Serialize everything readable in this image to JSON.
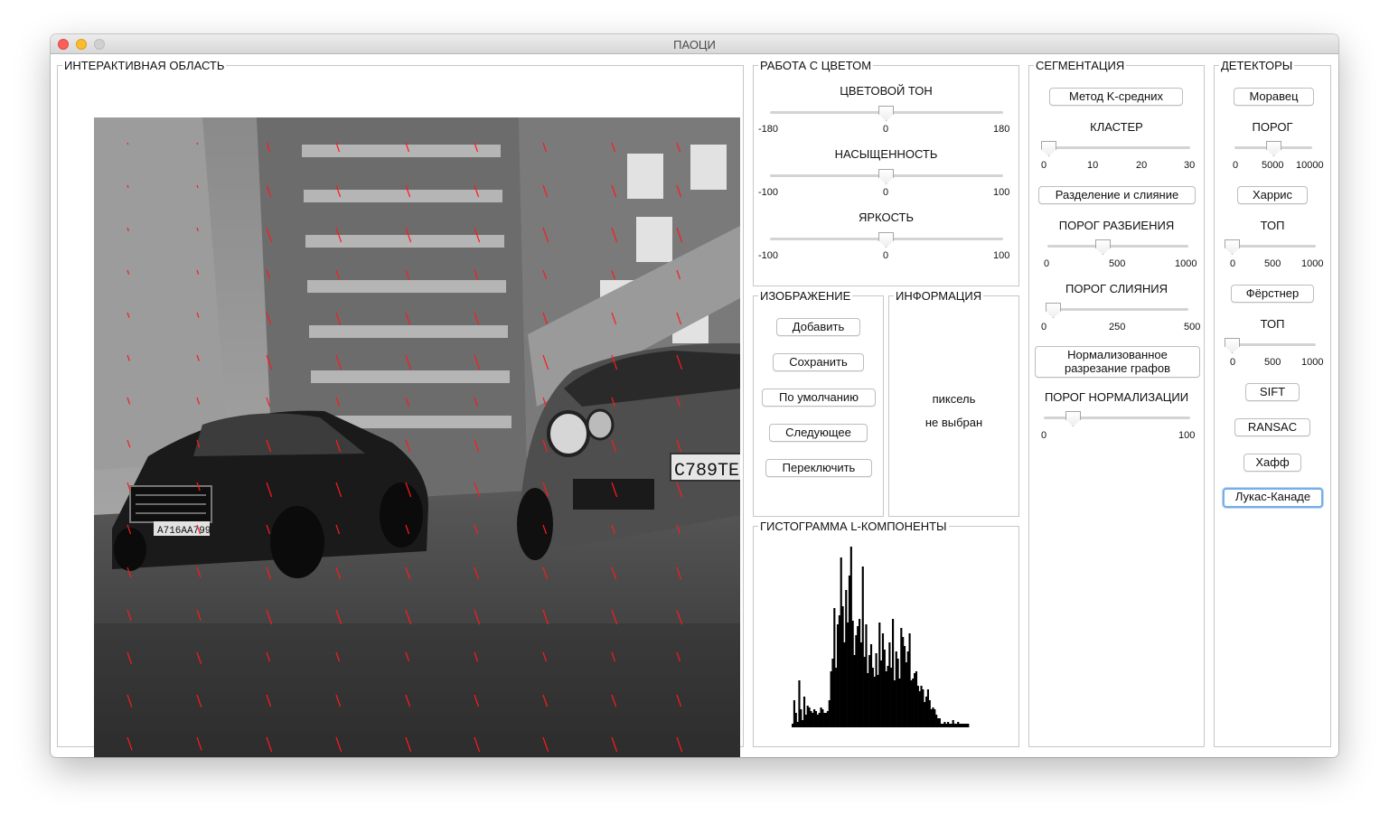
{
  "window": {
    "title": "ПАОЦИ"
  },
  "interactive": {
    "legend": "ИНТЕРАКТИВНАЯ ОБЛАСТЬ",
    "plates": [
      "А716АА799",
      "С789ТЕ"
    ]
  },
  "color": {
    "legend": "РАБОТА С ЦВЕТОМ",
    "hue": {
      "label": "ЦВЕТОВОЙ ТОН",
      "min": "-180",
      "mid": "0",
      "max": "180",
      "value": 0
    },
    "saturation": {
      "label": "НАСЫЩЕННОСТЬ",
      "min": "-100",
      "mid": "0",
      "max": "100",
      "value": 0
    },
    "brightness": {
      "label": "ЯРКОСТЬ",
      "min": "-100",
      "mid": "0",
      "max": "100",
      "value": 0
    }
  },
  "image": {
    "legend": "ИЗОБРАЖЕНИЕ",
    "add": "Добавить",
    "save": "Сохранить",
    "default": "По умолчанию",
    "next": "Следующее",
    "switch": "Переключить"
  },
  "info": {
    "legend": "ИНФОРМАЦИЯ",
    "line1": "пиксель",
    "line2": "не выбран"
  },
  "histogram": {
    "legend": "ГИСТОГРАММА L-КОМПОНЕНТЫ",
    "bars": [
      2,
      15,
      8,
      3,
      26,
      10,
      4,
      17,
      7,
      12,
      11,
      9,
      8,
      10,
      9,
      7,
      8,
      11,
      10,
      8,
      8,
      9,
      15,
      31,
      38,
      66,
      33,
      57,
      62,
      94,
      67,
      47,
      76,
      58,
      84,
      100,
      59,
      40,
      51,
      56,
      60,
      47,
      89,
      39,
      57,
      30,
      40,
      46,
      33,
      28,
      41,
      29,
      58,
      37,
      52,
      43,
      31,
      34,
      47,
      33,
      60,
      26,
      42,
      38,
      27,
      55,
      50,
      45,
      36,
      42,
      52,
      26,
      27,
      30,
      31,
      23,
      20,
      23,
      21,
      14,
      17,
      21,
      15,
      10,
      11,
      10,
      7,
      5,
      5,
      2,
      2,
      3,
      2,
      3,
      2,
      2,
      4,
      2,
      2,
      3,
      2,
      2,
      2,
      2,
      2,
      2
    ]
  },
  "segmentation": {
    "legend": "СЕГМЕНТАЦИЯ",
    "kmeans": "Метод K-средних",
    "cluster": {
      "label": "КЛАСТЕР",
      "ticks": [
        "0",
        "10",
        "20",
        "30"
      ],
      "value": 0
    },
    "split_merge": "Разделение и слияние",
    "split_threshold": {
      "label": "ПОРОГ РАЗБИЕНИЯ",
      "ticks": [
        "0",
        "500",
        "1000"
      ],
      "value": 400
    },
    "merge_threshold": {
      "label": "ПОРОГ СЛИЯНИЯ",
      "ticks": [
        "0",
        "250",
        "500"
      ],
      "value": 25
    },
    "normalized_cut_line1": "Нормализованное",
    "normalized_cut_line2": "разрезание графов",
    "norm_threshold": {
      "label": "ПОРОГ НОРМАЛИЗАЦИИ",
      "ticks": [
        "0",
        "100"
      ],
      "value": 20
    }
  },
  "detectors": {
    "legend": "ДЕТЕКТОРЫ",
    "moravec": "Моравец",
    "threshold": {
      "label": "ПОРОГ",
      "ticks": [
        "0",
        "5000",
        "10000"
      ],
      "value": 5000
    },
    "harris": "Харрис",
    "top1": {
      "label": "ТОП",
      "ticks": [
        "0",
        "500",
        "1000"
      ],
      "value": 0
    },
    "forstner": "Фёрстнер",
    "top2": {
      "label": "ТОП",
      "ticks": [
        "0",
        "500",
        "1000"
      ],
      "value": 0
    },
    "sift": "SIFT",
    "ransac": "RANSAC",
    "hough": "Хафф",
    "lucas_kanade": "Лукас-Канаде"
  },
  "colors": {
    "flow_vectors": "#ff1a1a",
    "focus_ring": "#78aee8",
    "histogram_fill": "#000000"
  }
}
